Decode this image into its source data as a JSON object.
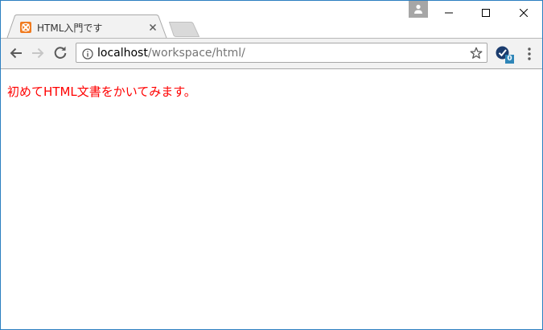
{
  "window": {
    "controls": {
      "minimize_icon": "minimize-icon",
      "maximize_icon": "maximize-icon",
      "close_icon": "close-icon",
      "profile_icon": "person-icon"
    }
  },
  "tab": {
    "title": "HTML入門です",
    "favicon": "xampp-icon",
    "close_icon": "close-icon"
  },
  "toolbar": {
    "back_icon": "arrow-left-icon",
    "forward_icon": "arrow-right-icon",
    "reload_icon": "reload-icon",
    "address": {
      "host": "localhost",
      "path": "/workspace/html/"
    },
    "bookmark_icon": "star-icon",
    "extension": {
      "icon": "checkmark-extension-icon",
      "badge": "0"
    },
    "menu_icon": "kebab-menu-icon"
  },
  "page": {
    "text": "初めてHTML文書をかいてみます。",
    "text_color": "#ff0000"
  },
  "colors": {
    "window_border": "#2b7fc1",
    "favicon": "#f07a1e",
    "badge": "#2f86b8"
  }
}
